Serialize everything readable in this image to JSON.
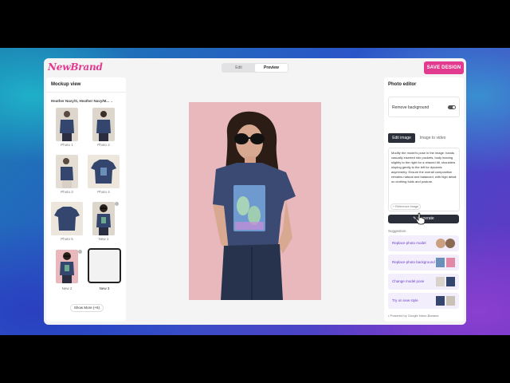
{
  "brand": {
    "logo": "NewBrand"
  },
  "header": {
    "tabs": [
      {
        "label": "Edit"
      },
      {
        "label": "Preview"
      }
    ],
    "save_label": "SAVE DESIGN"
  },
  "left_panel": {
    "title": "Mockup view",
    "variant": "Heather Navy/S, Heather Navy/M...",
    "photos": [
      {
        "label": "Photo 1"
      },
      {
        "label": "Photo 2"
      },
      {
        "label": "Photo 3"
      },
      {
        "label": "Photo 4"
      },
      {
        "label": "Photo 5"
      },
      {
        "label": "New 1"
      },
      {
        "label": "New 2"
      },
      {
        "label": "New 3"
      }
    ],
    "show_more": "Show More (+6)"
  },
  "right_panel": {
    "title": "Photo editor",
    "remove_background": "Remove background",
    "tabs": [
      {
        "label": "Edit image"
      },
      {
        "label": "Image to video"
      }
    ],
    "prompt": "Modify the model's pose in the image: hands casually inserted into pockets, body leaning slightly to the right for a relaxed tilt, shoulders sloping gently to the left for dynamic asymmetry. Ensure the overall composition remains natural and balanced, with high detail on clothing folds and posture.",
    "reference_image": "+ Reference image",
    "generate": "Generate",
    "suggestion_label": "Suggestion",
    "suggestions": [
      {
        "label": "Replace photo model"
      },
      {
        "label": "Replace photo background"
      },
      {
        "label": "Change model pose"
      },
      {
        "label": "Try on new style"
      }
    ],
    "powered_by": "Powered by Google Nano-Banana"
  },
  "colors": {
    "brand": "#e23a8f",
    "dark_button": "#2a2f3a",
    "suggestion_bg": "#f3eefb",
    "suggestion_text": "#6b3fc9"
  }
}
